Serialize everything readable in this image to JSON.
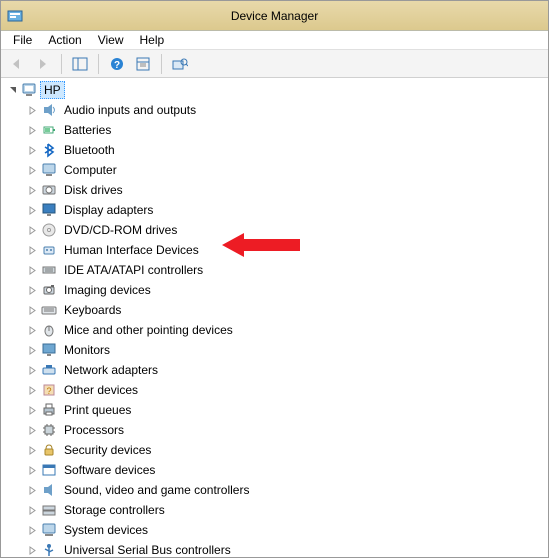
{
  "window": {
    "title": "Device Manager"
  },
  "menu": {
    "file": "File",
    "action": "Action",
    "view": "View",
    "help": "Help"
  },
  "tree": {
    "root": {
      "label": "HP",
      "expanded": true,
      "selected": true
    },
    "children": [
      {
        "label": "Audio inputs and outputs",
        "icon": "speaker"
      },
      {
        "label": "Batteries",
        "icon": "battery"
      },
      {
        "label": "Bluetooth",
        "icon": "bluetooth"
      },
      {
        "label": "Computer",
        "icon": "computer"
      },
      {
        "label": "Disk drives",
        "icon": "disk"
      },
      {
        "label": "Display adapters",
        "icon": "display"
      },
      {
        "label": "DVD/CD-ROM drives",
        "icon": "dvd"
      },
      {
        "label": "Human Interface Devices",
        "icon": "hid"
      },
      {
        "label": "IDE ATA/ATAPI controllers",
        "icon": "ide"
      },
      {
        "label": "Imaging devices",
        "icon": "camera"
      },
      {
        "label": "Keyboards",
        "icon": "keyboard"
      },
      {
        "label": "Mice and other pointing devices",
        "icon": "mouse"
      },
      {
        "label": "Monitors",
        "icon": "monitor"
      },
      {
        "label": "Network adapters",
        "icon": "network"
      },
      {
        "label": "Other devices",
        "icon": "other"
      },
      {
        "label": "Print queues",
        "icon": "printer"
      },
      {
        "label": "Processors",
        "icon": "cpu"
      },
      {
        "label": "Security devices",
        "icon": "security"
      },
      {
        "label": "Software devices",
        "icon": "software"
      },
      {
        "label": "Sound, video and game controllers",
        "icon": "sound"
      },
      {
        "label": "Storage controllers",
        "icon": "storage"
      },
      {
        "label": "System devices",
        "icon": "system"
      },
      {
        "label": "Universal Serial Bus controllers",
        "icon": "usb"
      }
    ]
  }
}
